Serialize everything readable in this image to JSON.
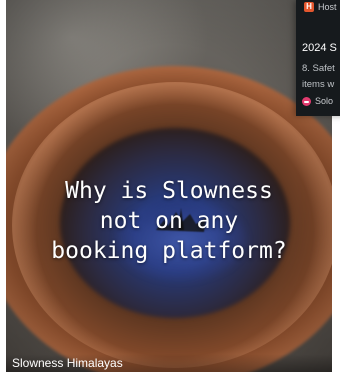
{
  "hero": {
    "headline": "Why is Slowness\nnot on any\nbooking platform?",
    "caption": "Slowness Himalayas"
  },
  "side_card": {
    "source_label": "Host",
    "source_icon": "h-logo-icon",
    "title": "2024 S",
    "snippet": "8. Safet\nitems w",
    "author": "Solo",
    "author_icon": "solo-logo-icon"
  },
  "colors": {
    "source_icon": "#e4572e",
    "author_icon": "#e23b6f",
    "side_card_bg": "#161a1d"
  }
}
